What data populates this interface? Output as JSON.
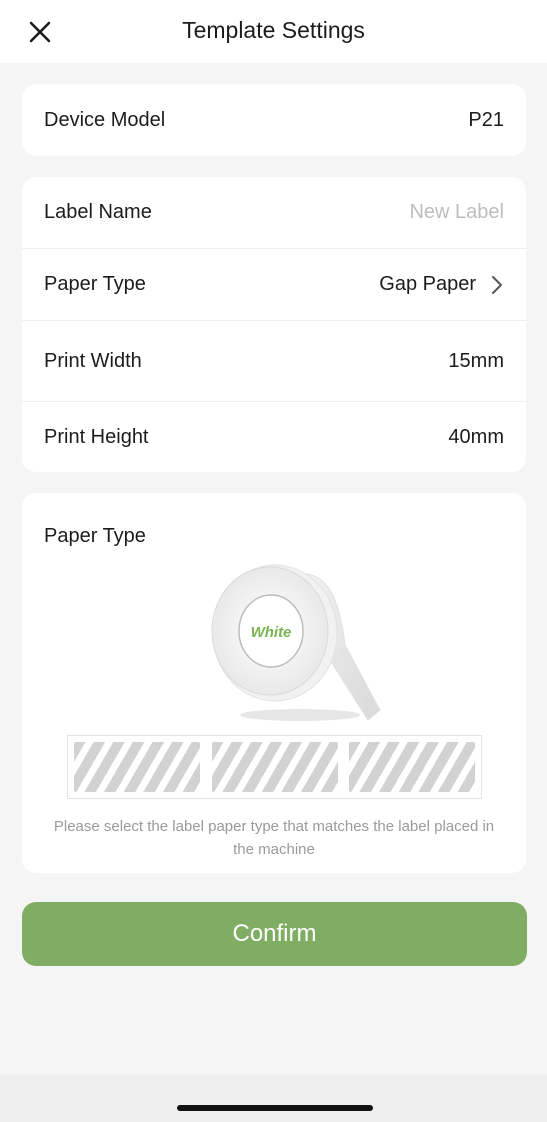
{
  "header": {
    "title": "Template Settings",
    "close_icon": "close-icon"
  },
  "device": {
    "label": "Device Model",
    "value": "P21"
  },
  "settings": {
    "label_name": {
      "label": "Label Name",
      "placeholder": "New Label"
    },
    "paper_type": {
      "label": "Paper Type",
      "value": "Gap Paper"
    },
    "print_width": {
      "label": "Print Width",
      "value": "15mm"
    },
    "print_height": {
      "label": "Print Height",
      "value": "40mm"
    }
  },
  "preview": {
    "title": "Paper Type",
    "roll_text": "White",
    "hint": "Please select the label paper type that matches the label placed in the machine"
  },
  "confirm_label": "Confirm",
  "colors": {
    "accent": "#7fad63",
    "background": "#f5f5f5",
    "placeholder": "#bdbdbd"
  }
}
